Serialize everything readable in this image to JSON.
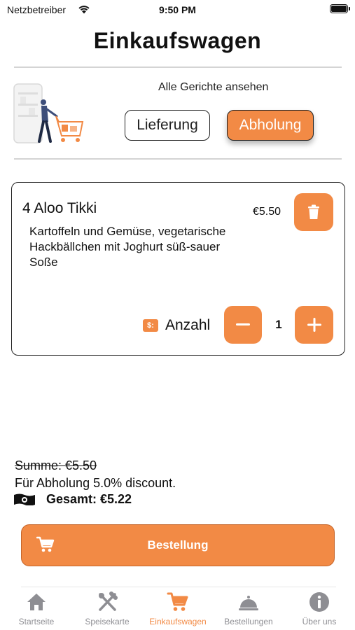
{
  "status_bar": {
    "carrier": "Netzbetreiber",
    "time": "9:50 PM"
  },
  "page": {
    "title": "Einkaufswagen"
  },
  "delivery_mode": {
    "see_all_dishes": "Alle Gerichte ansehen",
    "options": [
      "Lieferung",
      "Abholung"
    ],
    "selected": "Abholung"
  },
  "cart_item": {
    "name": "4 Aloo Tikki",
    "description": "Kartoffeln und Gemüse, vegetarische Hackbällchen mit Joghurt süß-sauer Soße",
    "price": "€5.50",
    "quantity_label": "Anzahl",
    "quantity": "1"
  },
  "summary": {
    "subtotal": "Summe: €5.50",
    "discount_note": "Für Abholung 5.0% discount.",
    "total": "Gesamt: €5.22"
  },
  "order_button": {
    "label": "Bestellung"
  },
  "tab_bar": {
    "items": [
      {
        "label": "Startseite",
        "icon": "home-icon"
      },
      {
        "label": "Speisekarte",
        "icon": "fork-knife-icon"
      },
      {
        "label": "Einkaufswagen",
        "icon": "cart-icon"
      },
      {
        "label": "Bestellungen",
        "icon": "cloche-icon"
      },
      {
        "label": "Über uns",
        "icon": "info-icon"
      }
    ],
    "active": "Einkaufswagen"
  },
  "colors": {
    "accent": "#f28a45",
    "inactive": "#8e8e93",
    "text": "#111111"
  }
}
